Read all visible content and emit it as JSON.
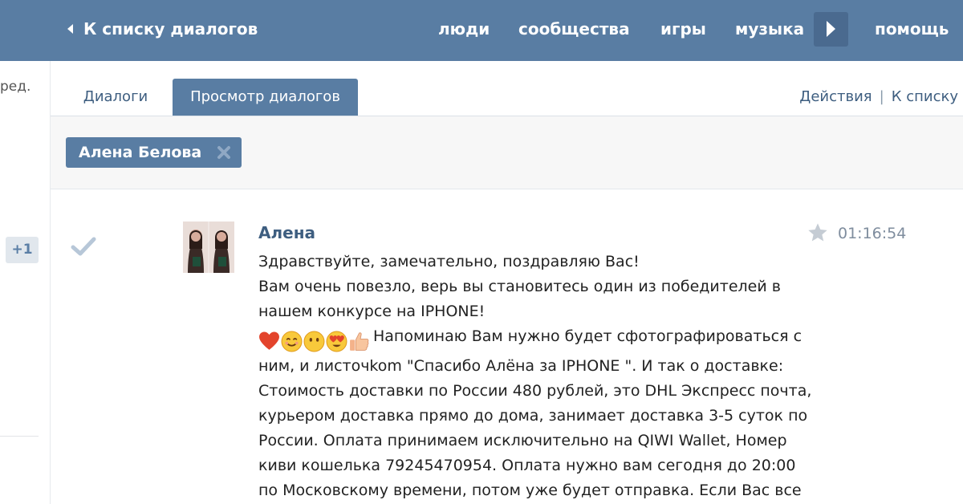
{
  "topbar": {
    "back_label": "К списку диалогов",
    "nav": [
      "люди",
      "сообщества",
      "игры",
      "музыка",
      "помощь"
    ]
  },
  "sidebar": {
    "fragment_text": "ред.",
    "badge": "+1"
  },
  "tabs": {
    "dialogs": "Диалоги",
    "view": "Просмотр диалогов"
  },
  "actions": {
    "actions_label": "Действия",
    "separator": "|",
    "to_list_label": "К списку"
  },
  "filter": {
    "chip_name": "Алена Белова"
  },
  "message": {
    "author": "Алена",
    "time": "01:16:54",
    "line1": "Здравствуйте, замечательно, поздравляю Вас!",
    "line2": "Вам очень повезло, верь вы становитесь один из победителей в нашем конкурсе на IPHONE!",
    "body": "Напоминаю Вам нужно будет сфотографироваться с ним, и листочkom \"Спасибо Алёна за IPHONE \". И так о доставке: Стоимость доставки по России 480 рублей, это DHL Экспресс почта, курьером доставка прямо до дома, занимает доставка 3-5 суток по России. Оплата принимаем исключительно на QIWI Wallet, Номер киви кошелька 79245470954. Оплата нужно вам сегодня до 20:00 по Московскому времени, потом уже будет отправка. Если Вас все",
    "emoji_icons": [
      "heart-icon",
      "smile-icon",
      "neutral-face-icon",
      "heart-eyes-icon",
      "thumbs-up-icon"
    ]
  },
  "colors": {
    "header": "#597da3",
    "link": "#3e5e80"
  }
}
